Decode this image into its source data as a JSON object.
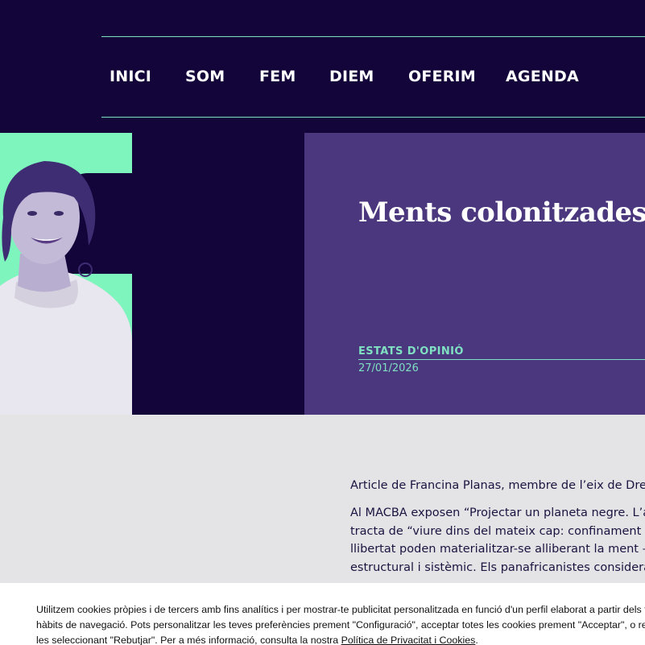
{
  "nav": {
    "items": [
      "INICI",
      "SOM",
      "FEM",
      "DIEM",
      "OFERIM",
      "AGENDA"
    ]
  },
  "article": {
    "title": "Ments colonitzades?",
    "category": "ESTATS D'OPINIÓ",
    "date": "27/01/2026",
    "intro": "Article de Francina Planas, membre de l’eix de Drets",
    "body_lines": [
      "Al MACBA exposen “Projectar un planeta negre. L’art",
      "tracta de “viure dins del mateix cap: confinament cor",
      "llibertat poden materialitzar-se alliberant la ment –de",
      "estructural i sistèmic. Els panafricanistes considerave"
    ]
  },
  "cookie": {
    "line1": "Utilitzem cookies pròpies i de tercers amb fins analítics i per mostrar-te publicitat personalitzada en funció d'un perfil elaborat a partir dels teus",
    "line2": "hàbits de navegació. Pots personalitzar les teves preferències prement \"Configuració\", acceptar totes les cookies prement \"Acceptar\", o rebutjar-",
    "line3": "les seleccionant \"Rebutjar\". Per a més informació, consulta la nostra ",
    "link": "Política de Privacitat i Cookies",
    "line3_end": "."
  },
  "colors": {
    "navy": "#13053a",
    "purple": "#4a377e",
    "mint": "#7fe0c2",
    "page_bg": "#e4e3e6"
  }
}
